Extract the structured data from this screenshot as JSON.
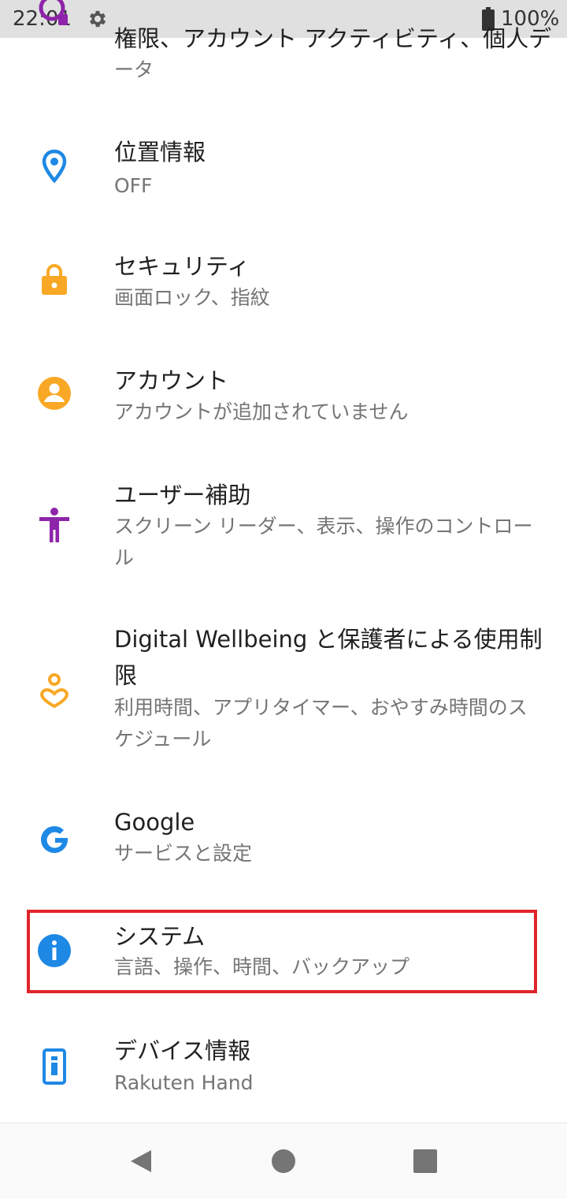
{
  "status_bar": {
    "time": "22:01",
    "battery": "100%",
    "icons": [
      "gear-icon",
      "battery-icon"
    ]
  },
  "settings": {
    "partial_top": {
      "line1": "権限、アカウント アクティビティ、個人デ",
      "line2": "ータ",
      "icon": "privacy-icon"
    },
    "items": [
      {
        "title": "位置情報",
        "subtitle": "OFF",
        "icon": "location-pin-icon",
        "color": "#1e88e5"
      },
      {
        "title": "セキュリティ",
        "subtitle": "画面ロック、指紋",
        "icon": "lock-icon",
        "color": "#f9a825"
      },
      {
        "title": "アカウント",
        "subtitle": "アカウントが追加されていません",
        "icon": "account-icon",
        "color": "#f9a825"
      },
      {
        "title": "ユーザー補助",
        "subtitle": "スクリーン リーダー、表示、操作のコントロール",
        "icon": "accessibility-icon",
        "color": "#8e24aa"
      },
      {
        "title": "Digital Wellbeing と保護者による使用制限",
        "subtitle": "利用時間、アプリタイマー、おやすみ時間のスケジュール",
        "icon": "wellbeing-icon",
        "color": "#f9a825"
      },
      {
        "title": "Google",
        "subtitle": "サービスと設定",
        "icon": "google-g-icon",
        "color": "#1e88e5"
      },
      {
        "title": "システム",
        "subtitle": "言語、操作、時間、バックアップ",
        "icon": "info-icon",
        "color": "#1e88e5"
      },
      {
        "title": "デバイス情報",
        "subtitle": "Rakuten Hand",
        "icon": "device-info-icon",
        "color": "#1e88e5"
      }
    ]
  },
  "highlight_color": "#e0242b",
  "nav_bar": {
    "icons": [
      "back-triangle-icon",
      "home-circle-icon",
      "recents-square-icon"
    ]
  }
}
